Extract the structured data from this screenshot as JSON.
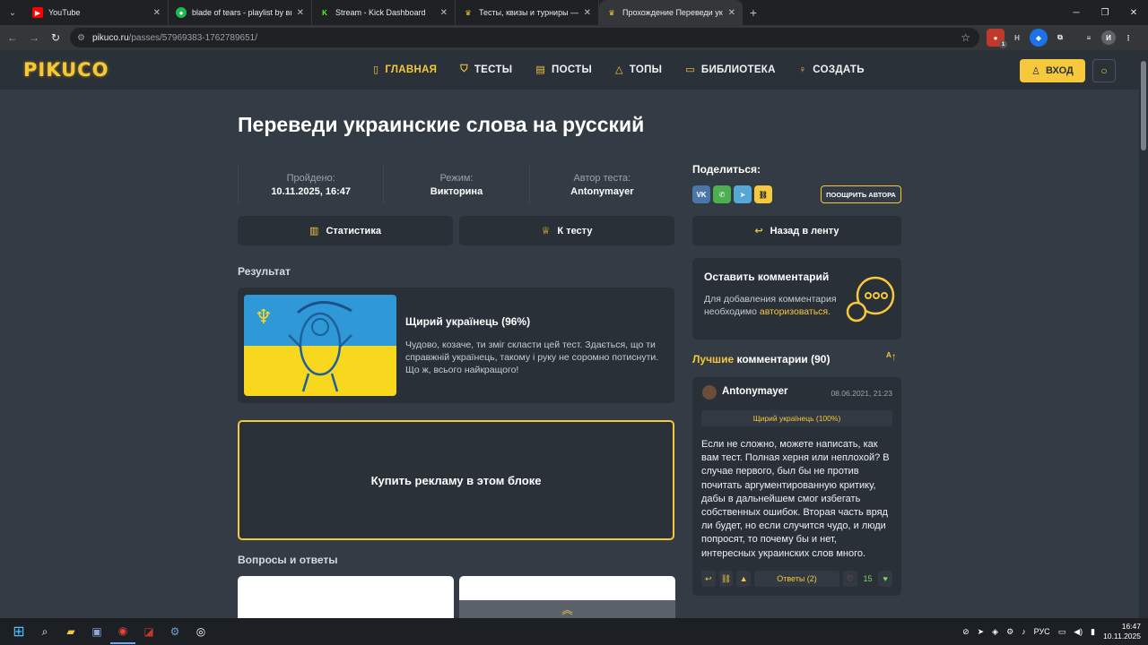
{
  "browser": {
    "tabs": [
      {
        "title": "YouTube",
        "color": "#ff0000",
        "glyph": "▶"
      },
      {
        "title": "blade of tears - playlist by выбо",
        "color": "#1db954",
        "glyph": "●"
      },
      {
        "title": "Stream - Kick Dashboard",
        "color": "#53fc18",
        "glyph": "K"
      },
      {
        "title": "Тесты, квизы и турниры — Pik",
        "color": "#f6c83b",
        "glyph": "P"
      },
      {
        "title": "Прохождение Переведи укра",
        "color": "#f6c83b",
        "glyph": "P"
      }
    ],
    "url_host": "pikuco.ru",
    "url_path": "/passes/57969383-1762789651/",
    "profile_initial": "И",
    "ext_badge": "1"
  },
  "site": {
    "logo": "PIKUCO",
    "nav": [
      "ГЛАВНАЯ",
      "ТЕСТЫ",
      "ПОСТЫ",
      "ТОПЫ",
      "БИБЛИОТЕКА",
      "СОЗДАТЬ"
    ],
    "login": "ВХОД"
  },
  "page": {
    "title": "Переведи украинские слова на русский",
    "meta": [
      {
        "label": "Пройдено:",
        "value": "10.11.2025, 16:47"
      },
      {
        "label": "Режим:",
        "value": "Викторина"
      },
      {
        "label": "Автор теста:",
        "value": "Antonymayer"
      }
    ],
    "buttons": {
      "stats": "Статистика",
      "to_test": "К тесту",
      "back": "Назад в ленту"
    },
    "result_heading": "Результат",
    "result": {
      "title": "Щирий українець (96%)",
      "text": "Чудово, козаче, ти зміг скласти цей тест. Здається, що ти справжній українець, такому і руку не соромно потиснути. Що ж, всього найкращого!"
    },
    "ad_text": "Купить рекламу в этом блоке",
    "qa_heading": "Вопросы и ответы"
  },
  "sidebar": {
    "share_label": "Поделиться:",
    "social": [
      {
        "name": "vk",
        "glyph": "VK",
        "color": "#4a76a8"
      },
      {
        "name": "whatsapp",
        "glyph": "W",
        "color": "#4caf50"
      },
      {
        "name": "telegram",
        "glyph": "➤",
        "color": "#56a7d6"
      },
      {
        "name": "link",
        "glyph": "🔗",
        "color": "#f6c83b"
      }
    ],
    "reward_author": "ПООЩРИТЬ АВТОРА",
    "comment_box": {
      "title": "Оставить комментарий",
      "text": "Для добавления комментария необходимо",
      "link": "авторизоваться."
    },
    "best_prefix": "Лучшие",
    "best_rest": "комментарии (90)",
    "comment": {
      "author": "Antonymayer",
      "date": "08.06.2021, 21:23",
      "badge": "Щирий українець (100%)",
      "text": "Если не сложно, можете написать, как вам тест. Полная херня или неплохой? В случае первого, был бы не против почитать аргументированную критику, дабы в дальнейшем смог избегать собственных ошибок. Вторая часть вряд ли будет, но если случится чудо, и люди попросят, то почему бы и нет, интересных украинских слов много.",
      "replies": "Ответы (2)",
      "likes": "15"
    }
  },
  "taskbar": {
    "lang": "РУС",
    "time": "16:47",
    "date": "10.11.2025"
  }
}
